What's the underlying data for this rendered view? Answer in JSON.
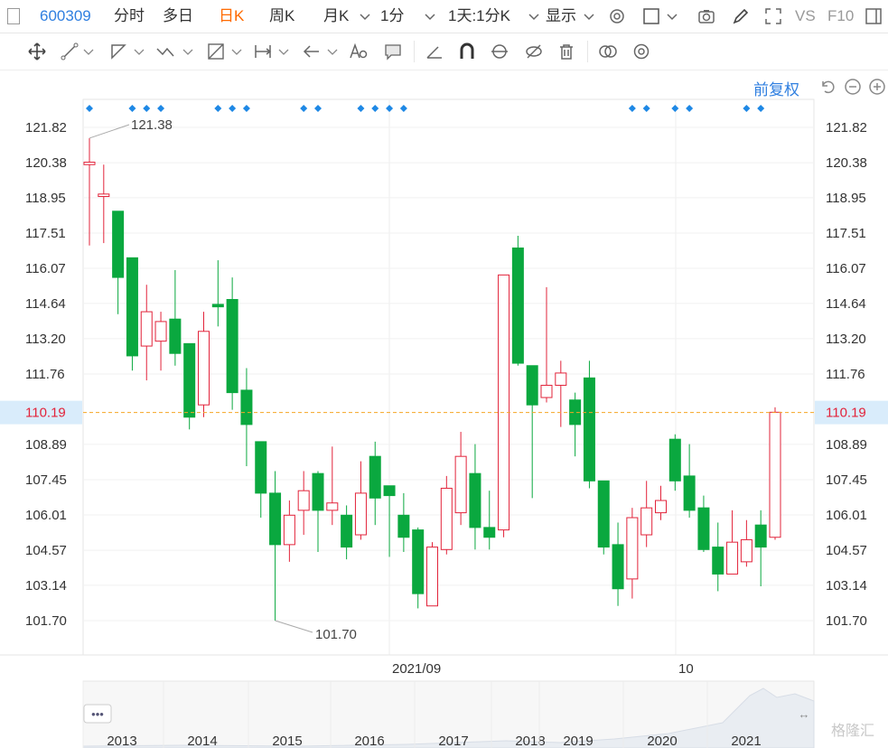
{
  "toolbar": {
    "symbol": "600309",
    "tabs": [
      "分时",
      "多日",
      "日K",
      "周K",
      "月K",
      "1分"
    ],
    "active_tab": "日K",
    "mode": "1天:1分K",
    "display": "显示",
    "vs": "VS",
    "f10": "F10"
  },
  "controls": {
    "adjust_label": "前复权"
  },
  "chart_data": {
    "type": "candlestick",
    "y_ticks": [
      121.82,
      120.38,
      118.95,
      117.51,
      116.07,
      114.64,
      113.2,
      111.76,
      110.19,
      108.89,
      107.45,
      106.01,
      104.57,
      103.14,
      101.7
    ],
    "ylim": [
      101.7,
      121.82
    ],
    "current_price": 110.19,
    "current_price_label": "110.19",
    "max_label": "121.38",
    "min_label": "101.70",
    "x_labels": [
      "2021/09",
      "10"
    ],
    "candles": [
      {
        "o": 120.3,
        "c": 120.4,
        "h": 121.38,
        "l": 117.0
      },
      {
        "o": 119.0,
        "c": 119.1,
        "h": 120.3,
        "l": 117.1
      },
      {
        "o": 118.4,
        "c": 115.7,
        "h": 118.4,
        "l": 114.2
      },
      {
        "o": 116.5,
        "c": 112.5,
        "h": 116.5,
        "l": 111.9
      },
      {
        "o": 112.9,
        "c": 114.3,
        "h": 115.4,
        "l": 111.5
      },
      {
        "o": 113.1,
        "c": 113.9,
        "h": 114.3,
        "l": 111.9
      },
      {
        "o": 114.0,
        "c": 112.6,
        "h": 116.0,
        "l": 112.1
      },
      {
        "o": 113.0,
        "c": 110.0,
        "h": 113.0,
        "l": 109.5
      },
      {
        "o": 110.5,
        "c": 113.5,
        "h": 114.3,
        "l": 110.0
      },
      {
        "o": 114.6,
        "c": 114.5,
        "h": 116.4,
        "l": 113.7
      },
      {
        "o": 114.8,
        "c": 111.0,
        "h": 115.7,
        "l": 110.3
      },
      {
        "o": 111.1,
        "c": 109.7,
        "h": 112.0,
        "l": 108.0
      },
      {
        "o": 109.0,
        "c": 106.9,
        "h": 109.0,
        "l": 105.9
      },
      {
        "o": 106.9,
        "c": 104.8,
        "h": 107.8,
        "l": 101.7
      },
      {
        "o": 104.8,
        "c": 106.0,
        "h": 106.6,
        "l": 104.1
      },
      {
        "o": 106.2,
        "c": 107.0,
        "h": 107.8,
        "l": 105.2
      },
      {
        "o": 107.7,
        "c": 106.2,
        "h": 107.8,
        "l": 104.5
      },
      {
        "o": 106.2,
        "c": 106.5,
        "h": 108.8,
        "l": 105.6
      },
      {
        "o": 106.0,
        "c": 104.7,
        "h": 106.4,
        "l": 104.2
      },
      {
        "o": 105.2,
        "c": 106.9,
        "h": 108.2,
        "l": 105.0
      },
      {
        "o": 108.4,
        "c": 106.7,
        "h": 109.0,
        "l": 105.6
      },
      {
        "o": 107.2,
        "c": 106.8,
        "h": 107.2,
        "l": 104.3
      },
      {
        "o": 106.0,
        "c": 105.1,
        "h": 106.9,
        "l": 104.5
      },
      {
        "o": 105.4,
        "c": 102.8,
        "h": 105.5,
        "l": 102.2
      },
      {
        "o": 102.3,
        "c": 104.7,
        "h": 104.9,
        "l": 102.3
      },
      {
        "o": 104.6,
        "c": 107.1,
        "h": 107.6,
        "l": 104.4
      },
      {
        "o": 106.1,
        "c": 108.4,
        "h": 109.4,
        "l": 105.6
      },
      {
        "o": 107.7,
        "c": 105.5,
        "h": 108.9,
        "l": 104.6
      },
      {
        "o": 105.5,
        "c": 105.1,
        "h": 107.0,
        "l": 104.6
      },
      {
        "o": 105.4,
        "c": 115.8,
        "h": 115.8,
        "l": 105.1
      },
      {
        "o": 116.9,
        "c": 112.2,
        "h": 117.4,
        "l": 112.1
      },
      {
        "o": 112.1,
        "c": 110.5,
        "h": 112.1,
        "l": 106.7
      },
      {
        "o": 110.8,
        "c": 111.3,
        "h": 115.3,
        "l": 110.6
      },
      {
        "o": 111.3,
        "c": 111.8,
        "h": 112.3,
        "l": 109.6
      },
      {
        "o": 110.7,
        "c": 109.7,
        "h": 111.0,
        "l": 108.4
      },
      {
        "o": 111.6,
        "c": 107.4,
        "h": 112.3,
        "l": 107.1
      },
      {
        "o": 107.4,
        "c": 104.7,
        "h": 107.4,
        "l": 104.4
      },
      {
        "o": 104.8,
        "c": 103.0,
        "h": 105.7,
        "l": 102.3
      },
      {
        "o": 103.4,
        "c": 105.9,
        "h": 106.3,
        "l": 102.6
      },
      {
        "o": 105.2,
        "c": 106.3,
        "h": 107.4,
        "l": 104.7
      },
      {
        "o": 106.1,
        "c": 106.6,
        "h": 107.2,
        "l": 105.8
      },
      {
        "o": 109.1,
        "c": 107.4,
        "h": 109.3,
        "l": 107.0
      },
      {
        "o": 107.6,
        "c": 106.2,
        "h": 108.9,
        "l": 105.9
      },
      {
        "o": 106.3,
        "c": 104.6,
        "h": 106.8,
        "l": 104.5
      },
      {
        "o": 104.7,
        "c": 103.6,
        "h": 105.7,
        "l": 102.9
      },
      {
        "o": 103.6,
        "c": 104.9,
        "h": 106.2,
        "l": 103.6
      },
      {
        "o": 104.1,
        "c": 105.0,
        "h": 105.8,
        "l": 103.9
      },
      {
        "o": 105.6,
        "c": 104.7,
        "h": 106.2,
        "l": 103.1
      },
      {
        "o": 105.1,
        "c": 110.2,
        "h": 110.4,
        "l": 105.0
      }
    ],
    "event_marker_indices": [
      0,
      3,
      4,
      5,
      9,
      10,
      11,
      15,
      16,
      19,
      20,
      21,
      22,
      38,
      39,
      41,
      42,
      46,
      47
    ],
    "navigator": {
      "year_labels": [
        "2013",
        "2014",
        "2015",
        "2016",
        "2017",
        "2018",
        "2019",
        "2020",
        "2021"
      ],
      "menu_glyph": "•••",
      "arrows": "↔",
      "watermark": "格隆汇"
    },
    "colors": {
      "up": "#e2233a",
      "down": "#0aa83f",
      "current_line": "#f5a623",
      "current_bg": "#d9ecfb",
      "axis_text": "#333333"
    }
  }
}
